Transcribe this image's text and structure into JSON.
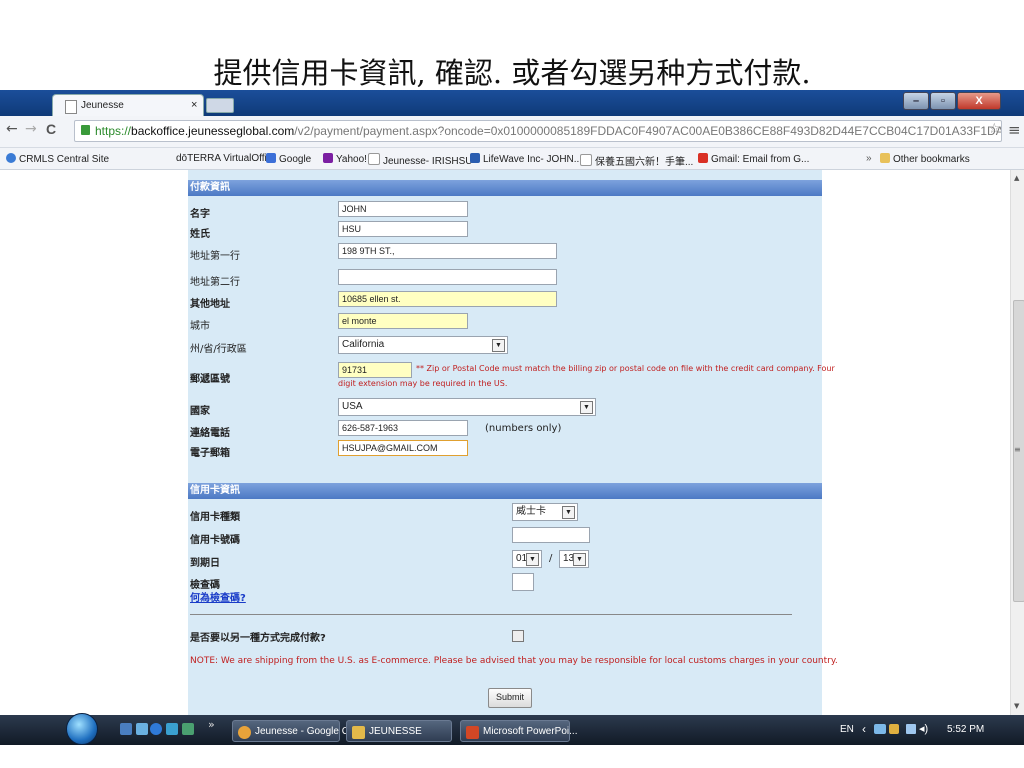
{
  "slide_title": "提供信用卡資訊, 確認. 或者勾選另种方式付款.",
  "browser": {
    "tab_title": "Jeunesse",
    "tab_close": "×",
    "url_https": "https://",
    "url_host": "backoffice.jeunesseglobal.com",
    "url_path": "/v2/payment/payment.aspx?oncode=0x0100000085189FDDAC0F4907AC00AE0B386CE88F493D82D44E7CCB04C17D01A33F1DA",
    "window_buttons": {
      "min": "–",
      "max": "▫",
      "close": "X"
    },
    "nav": {
      "back": "←",
      "forward": "→",
      "reload": "C",
      "star": "☆",
      "menu": "≡"
    },
    "bookmarks": [
      {
        "label": "CRMLS Central Site",
        "icon": "globe-icon",
        "color": "#3a7bd5"
      },
      {
        "label": "dōTERRA VirtualOffi...",
        "icon": "page-icon",
        "color": "#ffffff"
      },
      {
        "label": "Google",
        "icon": "google-icon",
        "color": "#3b6fd8"
      },
      {
        "label": "Yahoo!",
        "icon": "yahoo-icon",
        "color": "#7b1fa2"
      },
      {
        "label": "Jeunesse- IRISHSU",
        "icon": "page-icon",
        "color": "#ffffff"
      },
      {
        "label": "LifeWave Inc- JOHN...",
        "icon": "lifewave-icon",
        "color": "#2a5db0"
      },
      {
        "label": "保養五國六新！手筆...",
        "icon": "page-icon",
        "color": "#ffffff"
      },
      {
        "label": "Gmail: Email from G...",
        "icon": "gmail-icon",
        "color": "#d93025"
      }
    ],
    "bookmarks_more": "»",
    "other_bookmarks": "Other bookmarks"
  },
  "form": {
    "payment_section": "付款資訊",
    "fields": {
      "first_name": {
        "label": "名字",
        "value": "JOHN"
      },
      "last_name": {
        "label": "姓氏",
        "value": "HSU"
      },
      "address1": {
        "label": "地址第一行",
        "value": "198 9TH ST.,"
      },
      "address2": {
        "label": "地址第二行",
        "value": ""
      },
      "other_address": {
        "label": "其他地址",
        "value": "10685 ellen st."
      },
      "city": {
        "label": "城市",
        "value": "el monte"
      },
      "state": {
        "label": "州/省/行政區",
        "value": "California"
      },
      "zip": {
        "label": "郵遞區號",
        "value": "91731"
      },
      "country": {
        "label": "國家",
        "value": "USA"
      },
      "phone": {
        "label": "連絡電話",
        "value": "626-587-1963",
        "hint": "(numbers only)"
      },
      "email": {
        "label": "電子郵箱",
        "value": "HSUJPA@GMAIL.COM"
      }
    },
    "zip_note_line1": "** Zip or Postal Code must match the billing zip or postal code on file with the credit card company. Four",
    "zip_note_line2": "digit extension may be required in the US.",
    "card_section": "信用卡資訊",
    "card": {
      "type_label": "信用卡種類",
      "type_value": "威士卡",
      "number_label": "信用卡號碼",
      "number_value": "",
      "expiry_label": "到期日",
      "expiry_month": "01",
      "expiry_sep": "/",
      "expiry_year": "13",
      "cvv_label": "檢查碼",
      "cvv_value": "",
      "cvv_link": "何為檢查碼?"
    },
    "alt_payment_label": "是否要以另一種方式完成付款?",
    "alt_payment_checked": false,
    "note": "NOTE: We are shipping from the U.S. as E-commerce. Please be advised that you may be responsible for local customs charges in your country.",
    "submit": "Submit"
  },
  "taskbar": {
    "more": "»",
    "tasks": [
      {
        "label": "Jeunesse - Google C...",
        "icon": "chrome-icon",
        "color": "#e8a33a"
      },
      {
        "label": "JEUNESSE",
        "icon": "folder-icon",
        "color": "#e3b94a"
      },
      {
        "label": "Microsoft PowerPoi...",
        "icon": "powerpoint-icon",
        "color": "#d24726"
      }
    ],
    "lang": "EN",
    "tray_arrow": "‹",
    "time": "5:52 PM"
  }
}
